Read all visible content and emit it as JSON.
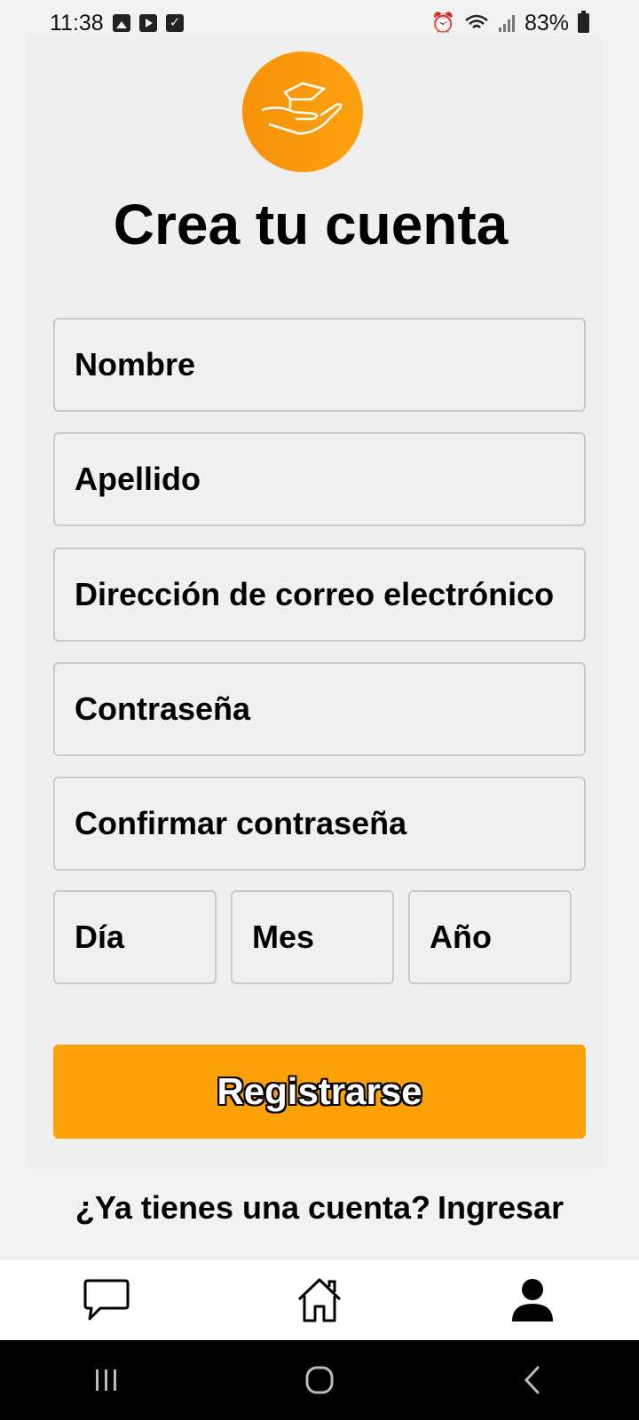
{
  "status_bar": {
    "time": "11:38",
    "battery": "83%",
    "icons_left": [
      "image-icon",
      "youtube-icon",
      "checkbox-icon"
    ],
    "icons_right": [
      "alarm-icon",
      "wifi-icon",
      "signal-icon",
      "battery-icon"
    ]
  },
  "logo": {
    "icon": "hand-holding-box-icon",
    "color": "#fba20e"
  },
  "page": {
    "title": "Crea tu cuenta"
  },
  "form": {
    "first_name_placeholder": "Nombre",
    "last_name_placeholder": "Apellido",
    "email_placeholder": "Dirección de correo electrónico",
    "password_placeholder": "Contraseña",
    "confirm_password_placeholder": "Confirmar contraseña",
    "day_placeholder": "Día",
    "month_placeholder": "Mes",
    "year_placeholder": "Año"
  },
  "actions": {
    "register_label": "Registrarse",
    "register_color": "#fba20b",
    "have_account_text": "¿Ya tienes una cuenta?",
    "login_link": "Ingresar"
  },
  "bottom_nav": {
    "items": [
      {
        "icon": "chat-icon"
      },
      {
        "icon": "home-icon"
      },
      {
        "icon": "profile-icon"
      }
    ]
  },
  "system_nav": {
    "items": [
      "recents-icon",
      "home-circle-icon",
      "back-icon"
    ]
  }
}
